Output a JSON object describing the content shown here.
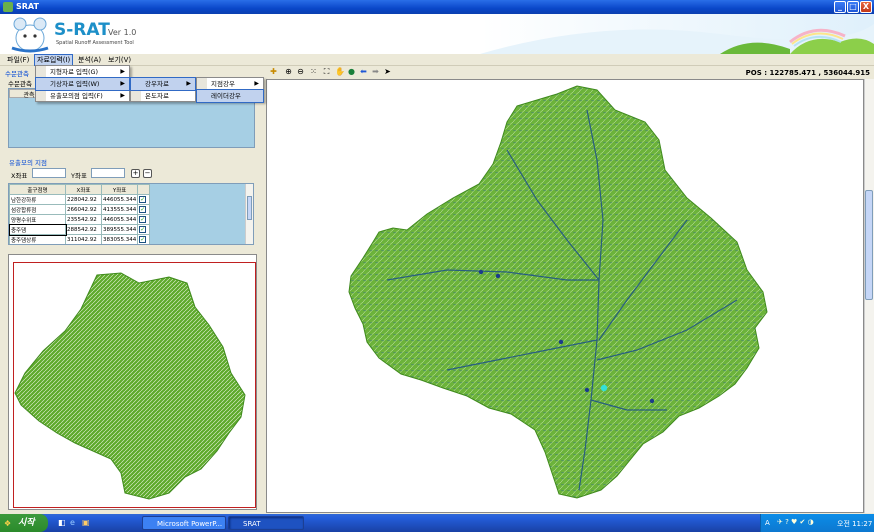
{
  "window": {
    "title": "SRAT",
    "min": "_",
    "max": "□",
    "close": "X"
  },
  "banner": {
    "logo_title": "S-RAT",
    "logo_ver": "Ver 1.0",
    "logo_sub": "Spatial Runoff Assessment Tool"
  },
  "menubar": {
    "items": [
      "파일(F)",
      "자료입력(I)",
      "분석(A)",
      "보기(V)"
    ]
  },
  "menu_input": {
    "items": [
      "지형자료 입력(G)",
      "기상자료 입력(W)",
      "유출모의점 입력(F)"
    ]
  },
  "menu_weather": {
    "items": [
      "강우자료",
      "온도자료"
    ]
  },
  "menu_rain": {
    "items": [
      "지점강우",
      "레이더강우"
    ]
  },
  "left": {
    "obs_group_label": "수문관측",
    "obs_sub_label": "수문관측",
    "obs_header": "관측",
    "outlet_group_label": "유출모의 지점",
    "x_label": "X좌표",
    "y_label": "Y좌표",
    "add_btn": "+",
    "remove_btn": "−",
    "outlet_columns": [
      "출구점명",
      "X좌표",
      "Y좌표",
      ""
    ],
    "outlet_rows": [
      {
        "name": "남한강하류",
        "x": "228042.92",
        "y": "446055.344",
        "checked": "✓"
      },
      {
        "name": "섬강합류점",
        "x": "266042.92",
        "y": "413555.344",
        "checked": "✓"
      },
      {
        "name": "양평수위표",
        "x": "235542.92",
        "y": "446055.344",
        "checked": "✓"
      },
      {
        "name": "충주댐",
        "x": "288542.92",
        "y": "389555.344",
        "checked": "✓"
      },
      {
        "name": "충주댐상류",
        "x": "311042.92",
        "y": "383055.344",
        "checked": "✓"
      }
    ]
  },
  "toolbar": {
    "icons": [
      "add-layer-icon",
      "zoom-in-icon",
      "zoom-out-icon",
      "full-extent-icon",
      "fit-icon",
      "pan-icon",
      "globe-icon",
      "back-arrow-icon",
      "forward-arrow-icon",
      "pointer-icon"
    ],
    "pos": "POS : 122785.471 , 536044.915"
  },
  "taskbar": {
    "start": "시작",
    "tasks": [
      "Microsoft PowerP...",
      "SRAT"
    ],
    "lang": "A",
    "clock": "오전 11:27"
  },
  "colors": {
    "basin_fill": "#6cb33a",
    "stream": "#1b4f8a",
    "frame_red": "#c02020"
  }
}
